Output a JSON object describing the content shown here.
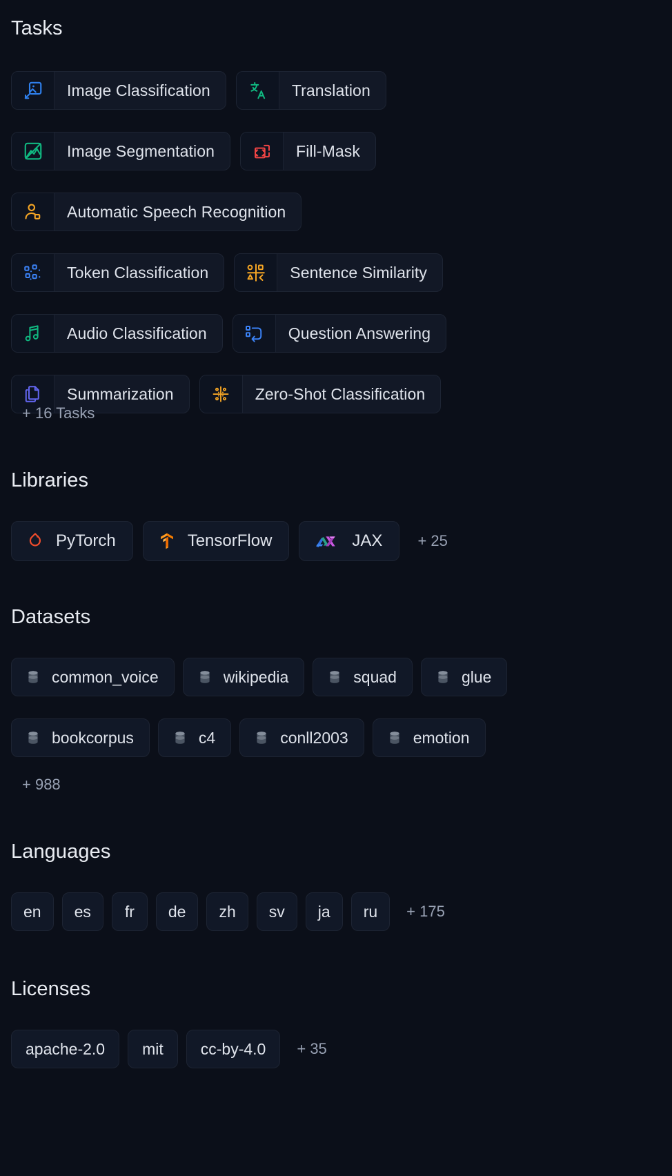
{
  "sections": {
    "tasks": {
      "title": "Tasks",
      "more_label": "+ 16 Tasks",
      "rows": [
        [
          {
            "label": "Image Classification",
            "icon": "image-classification-icon",
            "color": "#2f80ed"
          },
          {
            "label": "Translation",
            "icon": "translation-icon",
            "color": "#10b981"
          }
        ],
        [
          {
            "label": "Image Segmentation",
            "icon": "image-segmentation-icon",
            "color": "#10b981"
          },
          {
            "label": "Fill-Mask",
            "icon": "fill-mask-icon",
            "color": "#ef4444"
          }
        ],
        [
          {
            "label": "Automatic Speech Recognition",
            "icon": "speech-recognition-icon",
            "color": "#f5a524"
          }
        ],
        [
          {
            "label": "Token Classification",
            "icon": "token-classification-icon",
            "color": "#3b82f6"
          },
          {
            "label": "Sentence Similarity",
            "icon": "sentence-similarity-icon",
            "color": "#f5a524"
          }
        ],
        [
          {
            "label": "Audio Classification",
            "icon": "audio-classification-icon",
            "color": "#10b981"
          },
          {
            "label": "Question Answering",
            "icon": "question-answering-icon",
            "color": "#3b82f6"
          }
        ],
        [
          {
            "label": "Summarization",
            "icon": "summarization-icon",
            "color": "#6366f1"
          },
          {
            "label": "Zero-Shot Classification",
            "icon": "zero-shot-classification-icon",
            "color": "#f5a524"
          }
        ]
      ]
    },
    "libraries": {
      "title": "Libraries",
      "more_label": "+ 25",
      "items": [
        {
          "label": "PyTorch",
          "icon": "pytorch-logo",
          "color": "#ee4c2c"
        },
        {
          "label": "TensorFlow",
          "icon": "tensorflow-logo",
          "color": "#ff8c00"
        },
        {
          "label": "JAX",
          "icon": "jax-logo",
          "color": "#d946ef"
        }
      ]
    },
    "datasets": {
      "title": "Datasets",
      "more_label": "+ 988",
      "icon": "database-icon",
      "rows": [
        [
          "common_voice",
          "wikipedia",
          "squad",
          "glue"
        ],
        [
          "bookcorpus",
          "c4",
          "conll2003",
          "emotion"
        ]
      ]
    },
    "languages": {
      "title": "Languages",
      "more_label": "+ 175",
      "items": [
        "en",
        "es",
        "fr",
        "de",
        "zh",
        "sv",
        "ja",
        "ru"
      ]
    },
    "licenses": {
      "title": "Licenses",
      "more_label": "+ 35",
      "items": [
        "apache-2.0",
        "mit",
        "cc-by-4.0"
      ]
    }
  },
  "colors": {
    "background": "#0b0f19",
    "pill_background": "#111827",
    "pill_border": "#1d2433",
    "text_primary": "#dfe3eb",
    "text_muted": "#98a1b3"
  }
}
